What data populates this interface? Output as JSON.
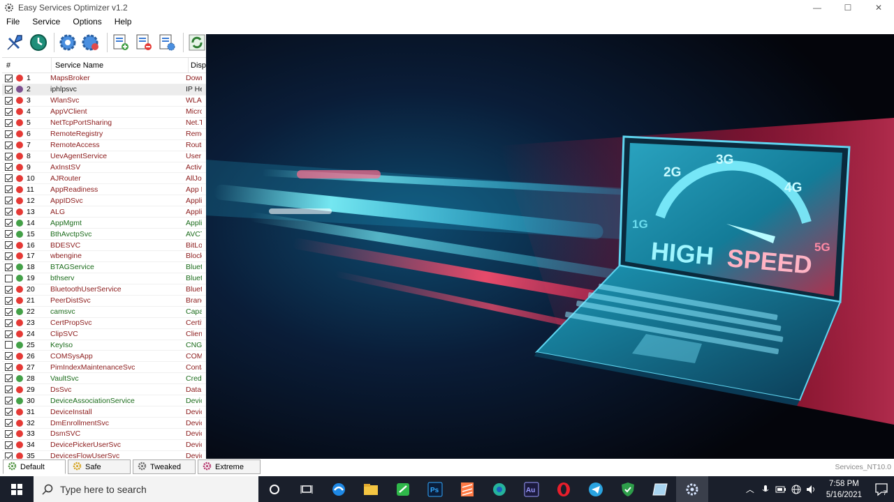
{
  "window": {
    "title": "Easy Services Optimizer v1.2",
    "controls": {
      "minimize": "—",
      "maximize": "☐",
      "close": "✕"
    }
  },
  "menu": [
    "File",
    "Service",
    "Options",
    "Help"
  ],
  "toolbar": {
    "icons": [
      "optimize-icon",
      "restore-icon",
      "service-gear-icon",
      "service-settings-icon",
      "add-list-icon",
      "remove-list-icon",
      "properties-list-icon",
      "refresh-icon"
    ]
  },
  "list": {
    "headers": {
      "num": "#",
      "name": "Service Name",
      "display": "Display Name"
    },
    "rows": [
      {
        "num": "1",
        "name": "MapsBroker",
        "disp": "Downloaded Maps Manager",
        "checked": true,
        "status": "red",
        "color": "#8b1a1a"
      },
      {
        "num": "2",
        "name": "iphlpsvc",
        "disp": "IP Helper",
        "checked": true,
        "status": "purple",
        "color": "#222222",
        "selected": true
      },
      {
        "num": "3",
        "name": "WlanSvc",
        "disp": "WLAN AutoConfig",
        "checked": true,
        "status": "red",
        "color": "#8b1a1a"
      },
      {
        "num": "4",
        "name": "AppVClient",
        "disp": "Microsoft App-V Client",
        "checked": true,
        "status": "red",
        "color": "#8b1a1a"
      },
      {
        "num": "5",
        "name": "NetTcpPortSharing",
        "disp": "Net.Tcp Port Sharing Service",
        "checked": true,
        "status": "red",
        "color": "#8b1a1a"
      },
      {
        "num": "6",
        "name": "RemoteRegistry",
        "disp": "Remote Registry",
        "checked": true,
        "status": "red",
        "color": "#8b1a1a"
      },
      {
        "num": "7",
        "name": "RemoteAccess",
        "disp": "Routing and Remote Access",
        "checked": true,
        "status": "red",
        "color": "#8b1a1a"
      },
      {
        "num": "8",
        "name": "UevAgentService",
        "disp": "User Experience Virtualization Service",
        "checked": true,
        "status": "red",
        "color": "#8b1a1a"
      },
      {
        "num": "9",
        "name": "AxInstSV",
        "disp": "ActiveX Installer (AxInstSV)",
        "checked": true,
        "status": "red",
        "color": "#8b1a1a"
      },
      {
        "num": "10",
        "name": "AJRouter",
        "disp": "AllJoyn Router Service",
        "checked": true,
        "status": "red",
        "color": "#8b1a1a"
      },
      {
        "num": "11",
        "name": "AppReadiness",
        "disp": "App Readiness",
        "checked": true,
        "status": "red",
        "color": "#8b1a1a"
      },
      {
        "num": "12",
        "name": "AppIDSvc",
        "disp": "Application Identity",
        "checked": true,
        "status": "red",
        "color": "#8b1a1a"
      },
      {
        "num": "13",
        "name": "ALG",
        "disp": "Application Layer Gateway Service",
        "checked": true,
        "status": "red",
        "color": "#8b1a1a"
      },
      {
        "num": "14",
        "name": "AppMgmt",
        "disp": "Application Management",
        "checked": true,
        "status": "green",
        "color": "#1a6b1a"
      },
      {
        "num": "15",
        "name": "BthAvctpSvc",
        "disp": "AVCTP service",
        "checked": true,
        "status": "green",
        "color": "#1a6b1a"
      },
      {
        "num": "16",
        "name": "BDESVC",
        "disp": "BitLocker Drive Encryption Service",
        "checked": true,
        "status": "red",
        "color": "#8b1a1a"
      },
      {
        "num": "17",
        "name": "wbengine",
        "disp": "Block Level Backup Engine Service",
        "checked": true,
        "status": "red",
        "color": "#8b1a1a"
      },
      {
        "num": "18",
        "name": "BTAGService",
        "disp": "Bluetooth Audio Gateway Service",
        "checked": true,
        "status": "green",
        "color": "#1a6b1a"
      },
      {
        "num": "19",
        "name": "bthserv",
        "disp": "Bluetooth Support Service",
        "checked": false,
        "status": "green",
        "color": "#1a6b1a"
      },
      {
        "num": "20",
        "name": "BluetoothUserService",
        "disp": "Bluetooth User Support Service",
        "checked": true,
        "status": "red",
        "color": "#8b1a1a"
      },
      {
        "num": "21",
        "name": "PeerDistSvc",
        "disp": "BranchCache",
        "checked": true,
        "status": "red",
        "color": "#8b1a1a"
      },
      {
        "num": "22",
        "name": "camsvc",
        "disp": "Capability Access Manager Service",
        "checked": true,
        "status": "green",
        "color": "#1a6b1a"
      },
      {
        "num": "23",
        "name": "CertPropSvc",
        "disp": "Certificate Propagation",
        "checked": true,
        "status": "red",
        "color": "#8b1a1a"
      },
      {
        "num": "24",
        "name": "ClipSVC",
        "disp": "Client License Service (ClipSVC)",
        "checked": true,
        "status": "red",
        "color": "#8b1a1a"
      },
      {
        "num": "25",
        "name": "KeyIso",
        "disp": "CNG Key Isolation",
        "checked": false,
        "status": "green",
        "color": "#1a6b1a"
      },
      {
        "num": "26",
        "name": "COMSysApp",
        "disp": "COM+ System Application",
        "checked": true,
        "status": "red",
        "color": "#8b1a1a"
      },
      {
        "num": "27",
        "name": "PimIndexMaintenanceSvc",
        "disp": "Contact Data",
        "checked": true,
        "status": "red",
        "color": "#8b1a1a"
      },
      {
        "num": "28",
        "name": "VaultSvc",
        "disp": "Credential Manager",
        "checked": true,
        "status": "green",
        "color": "#1a6b1a"
      },
      {
        "num": "29",
        "name": "DsSvc",
        "disp": "Data Sharing Service",
        "checked": true,
        "status": "red",
        "color": "#8b1a1a"
      },
      {
        "num": "30",
        "name": "DeviceAssociationService",
        "disp": "Device Association Service",
        "checked": true,
        "status": "green",
        "color": "#1a6b1a"
      },
      {
        "num": "31",
        "name": "DeviceInstall",
        "disp": "Device Install Service",
        "checked": true,
        "status": "red",
        "color": "#8b1a1a"
      },
      {
        "num": "32",
        "name": "DmEnrollmentSvc",
        "disp": "Device Management Enrollment Service",
        "checked": true,
        "status": "red",
        "color": "#8b1a1a"
      },
      {
        "num": "33",
        "name": "DsmSVC",
        "disp": "Device Setup Manager",
        "checked": true,
        "status": "red",
        "color": "#8b1a1a"
      },
      {
        "num": "34",
        "name": "DevicePickerUserSvc",
        "disp": "DevicePicker",
        "checked": true,
        "status": "red",
        "color": "#8b1a1a"
      },
      {
        "num": "35",
        "name": "DevicesFlowUserSvc",
        "disp": "DevicesFlow",
        "checked": true,
        "status": "red",
        "color": "#8b1a1a"
      }
    ]
  },
  "hero": {
    "speeds": [
      "1G",
      "2G",
      "3G",
      "4G",
      "5G"
    ],
    "headline_1": "HIGH",
    "headline_2": "SPEED"
  },
  "profiles": [
    "Default",
    "Safe",
    "Tweaked",
    "Extreme"
  ],
  "status_right": "Services_NT10.0",
  "taskbar": {
    "search_placeholder": "Type here to search",
    "time": "7:58 PM",
    "date": "5/16/2021",
    "notifications": "7",
    "apps": [
      "cortana-icon",
      "task-view-icon",
      "edge-icon",
      "file-explorer-icon",
      "sheets-icon",
      "photoshop-icon",
      "sublime-icon",
      "edge-dev-icon",
      "audition-icon",
      "opera-icon",
      "telegram-icon",
      "shield-vpn-icon",
      "notes-icon",
      "services-optimizer-icon"
    ]
  },
  "colors": {
    "status_red": "#e53935",
    "status_green": "#43a047",
    "status_purple": "#7b4f8e",
    "taskbar": "#1a1f2b"
  }
}
